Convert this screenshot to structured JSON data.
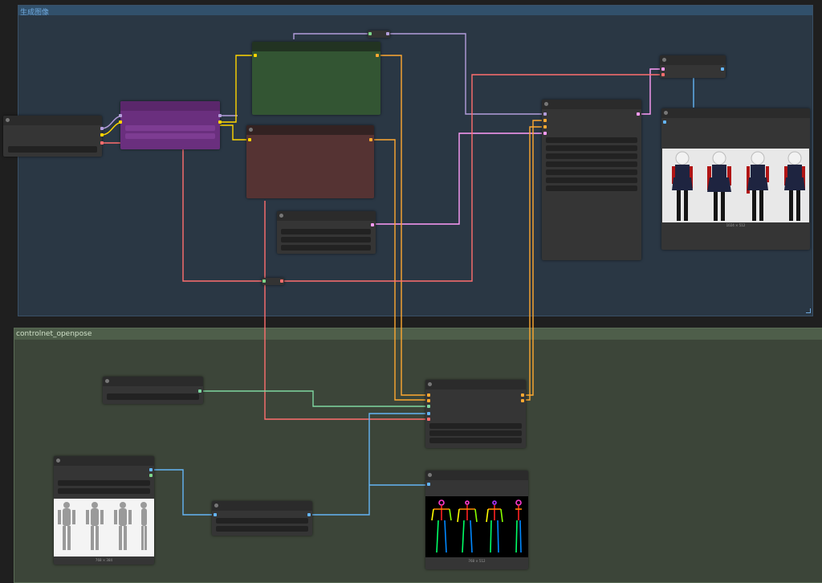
{
  "groups": {
    "top": {
      "title": "生成图像"
    },
    "bottom": {
      "title": "controlnet_openpose"
    }
  },
  "previews": {
    "character_sheet": {
      "caption": "1024 × 512"
    },
    "reference_bodies": {
      "caption": "768 × 384"
    },
    "openpose": {
      "caption": "768 × 512"
    }
  },
  "colors": {
    "model": "#b39ddb",
    "clip": "#ffd500",
    "vae": "#ff6e6e",
    "conditioning": "#ffa931",
    "latent": "#ff9cf9",
    "image": "#64b5f6",
    "control_net": "#00d78d",
    "group_top": "#335",
    "group_bottom": "#3f5"
  }
}
